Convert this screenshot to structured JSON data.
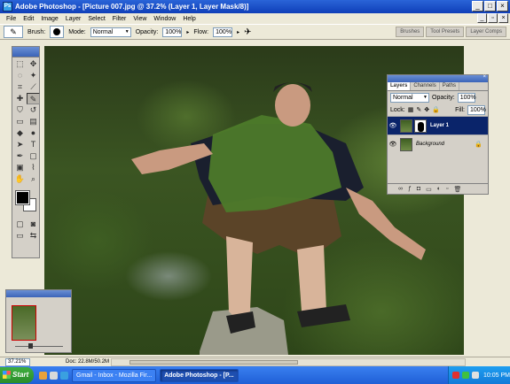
{
  "window": {
    "title": "Adobe Photoshop - [Picture 007.jpg @ 37.2% (Layer 1, Layer Mask/8)]",
    "app_badge": "Ps"
  },
  "menu": [
    "File",
    "Edit",
    "Image",
    "Layer",
    "Select",
    "Filter",
    "View",
    "Window",
    "Help"
  ],
  "options_bar": {
    "brush_label": "Brush:",
    "brush_size": "35",
    "mode_label": "Mode:",
    "mode_value": "Normal",
    "opacity_label": "Opacity:",
    "opacity_value": "100%",
    "flow_label": "Flow:",
    "flow_value": "100%",
    "wells": [
      "Brushes",
      "Tool Presets",
      "Layer Comps"
    ]
  },
  "layers_panel": {
    "tabs": [
      "Layers",
      "Channels",
      "Paths"
    ],
    "blend_mode": "Normal",
    "opacity_label": "Opacity:",
    "opacity_value": "100%",
    "lock_label": "Lock:",
    "fill_label": "Fill:",
    "fill_value": "100%",
    "layers": [
      {
        "name": "Layer 1",
        "selected": true
      },
      {
        "name": "Background",
        "selected": false
      }
    ]
  },
  "navigator": {
    "zoom_fraction": 0.3
  },
  "status_bar": {
    "zoom": "37.21%",
    "doc_info": "Doc: 22.8M/50.2M"
  },
  "taskbar": {
    "start_label": "Start",
    "tasks": [
      {
        "label": "Gmail - Inbox - Mozilla Fir...",
        "active": false
      },
      {
        "label": "Adobe Photoshop - [P...",
        "active": true
      }
    ],
    "clock": "10:05 PM"
  },
  "colors": {
    "titlebar": "#0f3fb8",
    "selection": "#0a246a",
    "foreground_color": "#000000",
    "background_color": "#ffffff"
  }
}
